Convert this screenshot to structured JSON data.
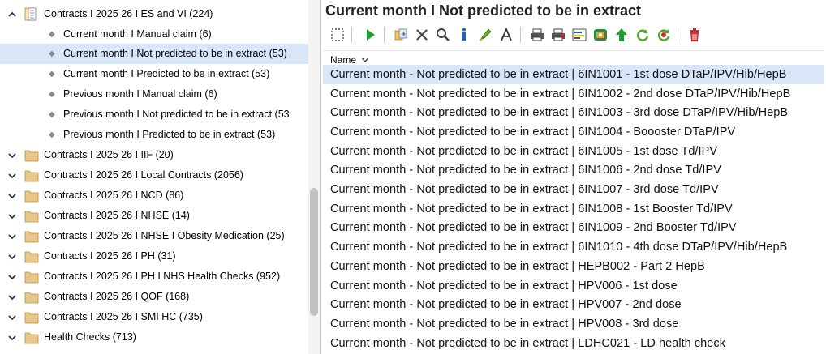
{
  "tree": {
    "expanded_node": {
      "label": "Contracts I 2025 26 I ES and VI (224)",
      "children": [
        "Current month I Manual claim (6)",
        "Current month I Not predicted to be in extract (53)",
        "Current month I Predicted to be in extract (53)",
        "Previous month I Manual claim (6)",
        "Previous month I Not predicted to be in extract (53",
        "Previous month I Predicted to be in extract (53)"
      ],
      "selected_child": 1
    },
    "collapsed_nodes": [
      "Contracts I 2025 26 I IIF (20)",
      "Contracts I 2025 26 I Local Contracts (2056)",
      "Contracts I 2025 26 I NCD (86)",
      "Contracts I 2025 26 I NHSE (14)",
      "Contracts I 2025 26 I NHSE I Obesity Medication (25)",
      "Contracts I 2025 26 I PH (31)",
      "Contracts I 2025 26 I PH I NHS Health Checks (952)",
      "Contracts I 2025 26 I QOF (168)",
      "Contracts I 2025 26 I SMI HC (735)",
      "Health Checks (713)"
    ]
  },
  "right": {
    "title": "Current month I Not predicted to be in extract",
    "column_header": "Name",
    "selected_row": 0,
    "rows": [
      "Current month - Not predicted to be in extract | 6IN1001 - 1st dose DTaP/IPV/Hib/HepB",
      "Current month - Not predicted to be in extract | 6IN1002 - 2nd dose DTaP/IPV/Hib/HepB",
      "Current month - Not predicted to be in extract | 6IN1003 - 3rd dose DTaP/IPV/Hib/HepB",
      "Current month - Not predicted to be in extract | 6IN1004 - Boooster DTaP/IPV",
      "Current month - Not predicted to be in extract | 6IN1005 - 1st dose Td/IPV",
      "Current month - Not predicted to be in extract | 6IN1006 - 2nd dose Td/IPV",
      "Current month - Not predicted to be in extract | 6IN1007 - 3rd dose Td/IPV",
      "Current month - Not predicted to be in extract | 6IN1008 - 1st Booster Td/IPV",
      "Current month - Not predicted to be in extract | 6IN1009 - 2nd Booster Td/IPV",
      "Current month - Not predicted to be in extract | 6IN1010 - 4th dose DTaP/IPV/Hib/HepB",
      "Current month - Not predicted to be in extract | HEPB002 - Part 2 HepB",
      "Current month - Not predicted to be in extract | HPV006 - 1st dose",
      "Current month - Not predicted to be in extract | HPV007 - 2nd dose",
      "Current month - Not predicted to be in extract | HPV008 - 3rd dose",
      "Current month - Not predicted to be in extract | LDHC021 - LD health check"
    ]
  },
  "toolbar": {
    "icons": [
      "select-icon",
      "run-icon",
      "copy-icon",
      "delete-icon",
      "search-icon",
      "info-icon",
      "highlight-icon",
      "font-icon",
      "print-icon",
      "print-report-icon",
      "report-icon",
      "export-icon",
      "move-up-icon",
      "refresh-icon",
      "refresh-red-icon",
      "trash-icon"
    ]
  },
  "colors": {
    "selection": "#d9e6f7",
    "folder": "#e8c88a",
    "run_green": "#1e9e2e",
    "delete_red": "#d32c2c"
  }
}
